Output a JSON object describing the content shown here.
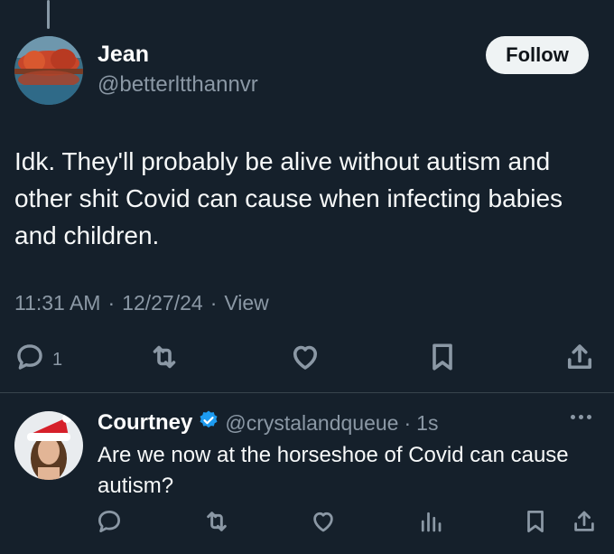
{
  "main_tweet": {
    "author_name": "Jean",
    "author_handle": "@betterltthannvr",
    "follow_label": "Follow",
    "text": "Idk. They'll probably be alive without autism and other shit Covid can cause when infecting babies and children.",
    "time": "11:31 AM",
    "separator": "·",
    "date": "12/27/24",
    "views_label": "View",
    "reply_count": "1"
  },
  "reply": {
    "author_name": "Courtney",
    "author_handle": "@crystalandqueue",
    "separator": "·",
    "time": "1s",
    "text": "Are we now at the horseshoe of Covid can cause autism?"
  },
  "icons": [
    "reply-icon",
    "retweet-icon",
    "like-icon",
    "bookmark-icon",
    "share-icon",
    "views-icon",
    "verified-icon",
    "more-icon"
  ],
  "colors": {
    "background": "#15202b",
    "text": "#f7f9f9",
    "muted": "#8b98a5",
    "verified": "#1d9bf0",
    "follow_bg": "#eff3f4"
  }
}
